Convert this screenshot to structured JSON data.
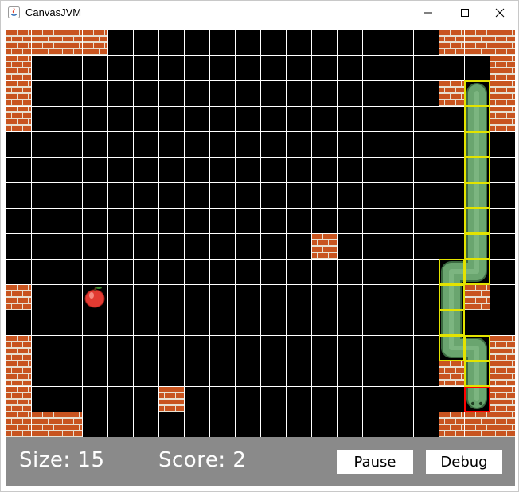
{
  "window": {
    "title": "CanvasJVM",
    "controls": {
      "minimize": "minimize-icon",
      "maximize": "maximize-icon",
      "close": "close-icon"
    }
  },
  "game": {
    "grid": {
      "cols": 20,
      "rows": 16
    },
    "colors": {
      "background": "#000000",
      "grid_line": "#ffffff",
      "snake_body": "#6aa56f",
      "snake_outline": "#3b6a40",
      "snake_debug_box": "#e3e300",
      "head_debug_box": "#ff0000",
      "brick": "#c8541f",
      "mortar": "#e8e0d0",
      "apple": "#e23b32",
      "status_bar": "#8a8a8a"
    },
    "walls": [
      [
        0,
        0
      ],
      [
        1,
        0
      ],
      [
        2,
        0
      ],
      [
        3,
        0
      ],
      [
        17,
        0
      ],
      [
        18,
        0
      ],
      [
        19,
        0
      ],
      [
        0,
        1
      ],
      [
        19,
        1
      ],
      [
        0,
        2
      ],
      [
        17,
        2
      ],
      [
        19,
        2
      ],
      [
        0,
        3
      ],
      [
        19,
        3
      ],
      [
        12,
        8
      ],
      [
        0,
        10
      ],
      [
        18,
        10
      ],
      [
        0,
        12
      ],
      [
        19,
        12
      ],
      [
        0,
        13
      ],
      [
        17,
        13
      ],
      [
        19,
        13
      ],
      [
        0,
        14
      ],
      [
        6,
        14
      ],
      [
        19,
        14
      ],
      [
        0,
        15
      ],
      [
        1,
        15
      ],
      [
        2,
        15
      ],
      [
        17,
        15
      ],
      [
        18,
        15
      ],
      [
        19,
        15
      ]
    ],
    "apple": [
      3,
      10
    ],
    "snake": [
      [
        18,
        14
      ],
      [
        18,
        13
      ],
      [
        18,
        12
      ],
      [
        17,
        12
      ],
      [
        17,
        11
      ],
      [
        17,
        10
      ],
      [
        17,
        9
      ],
      [
        18,
        9
      ],
      [
        18,
        8
      ],
      [
        18,
        7
      ],
      [
        18,
        6
      ],
      [
        18,
        5
      ],
      [
        18,
        4
      ],
      [
        18,
        3
      ],
      [
        18,
        2
      ]
    ]
  },
  "status": {
    "size_text": "Size: 15",
    "score_text": "Score: 2",
    "pause_label": "Pause",
    "debug_label": "Debug"
  }
}
